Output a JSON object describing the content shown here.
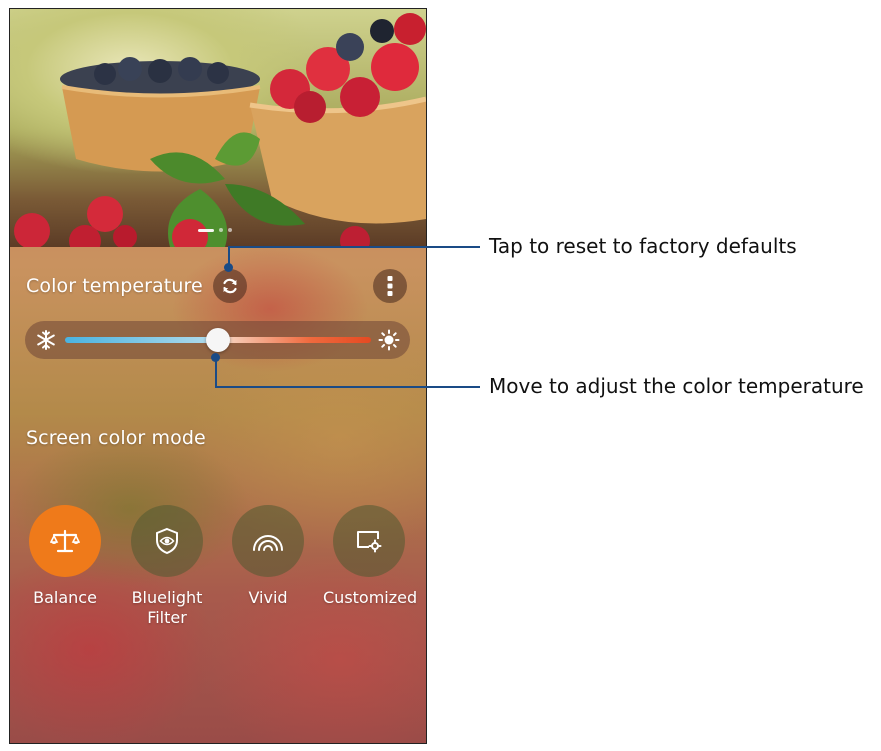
{
  "color_temperature": {
    "title": "Color temperature",
    "level": 0.5
  },
  "screen_color_mode": {
    "title": "Screen color mode",
    "selected": "Balance",
    "modes": [
      {
        "label": "Balance",
        "icon": "balance-scale-icon"
      },
      {
        "label": "Bluelight Filter",
        "label_line1": "Bluelight",
        "label_line2": "Filter",
        "icon": "shield-eye-icon"
      },
      {
        "label": "Vivid",
        "icon": "rainbow-arc-icon"
      },
      {
        "label": "Customized",
        "icon": "screen-gear-icon"
      }
    ]
  },
  "callouts": {
    "reset": "Tap to reset to factory defaults",
    "adjust": "Move to adjust the color temperature"
  },
  "colors": {
    "accent": "#ef7a1a",
    "callout": "#1a4b86",
    "slider_cool": "#4ab3e0",
    "slider_warm": "#e54a22"
  }
}
